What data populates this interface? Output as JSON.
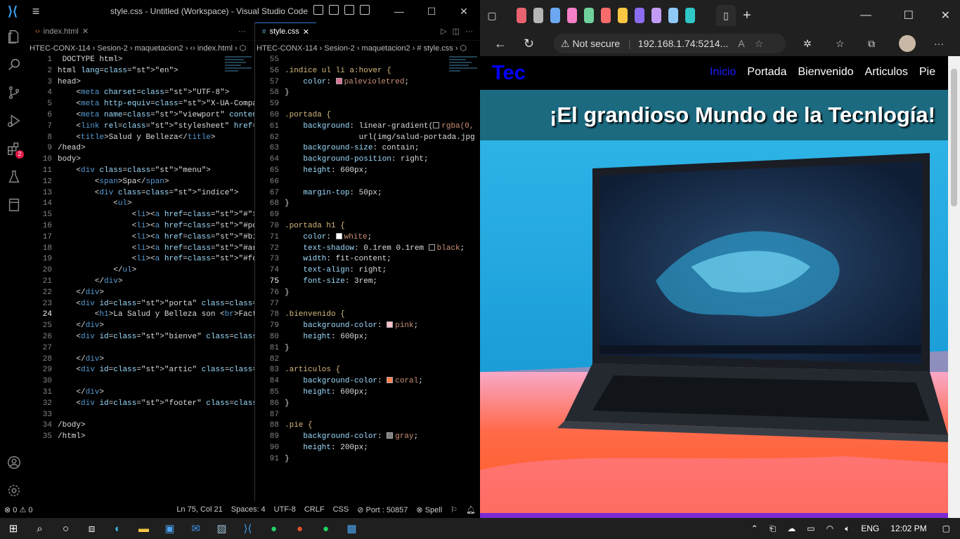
{
  "vscode": {
    "title": "style.css - Untitled (Workspace) - Visual Studio Code",
    "left_tab": "index.html",
    "right_tab": "style.css",
    "left_breadcrumb": "HTEC-CONX-114 › Sesion-2 › maquetacion2 › ‹› index.html › ⬡",
    "right_breadcrumb": "HTEC-CONX-114 › Sesion-2 › maquetacion2 › # style.css › ⬡",
    "activity_badge": "2",
    "status": {
      "errors": "⊗ 0 ⚠ 0",
      "position": "Ln 75, Col 21",
      "spaces": "Spaces: 4",
      "encoding": "UTF-8",
      "eol": "CRLF",
      "lang": "CSS",
      "port": "⊘ Port : 50857",
      "spell": "⊗ Spell"
    }
  },
  "html_lines": [
    {
      "n": "1",
      "t": " DOCTYPE html>"
    },
    {
      "n": "2",
      "t": "html lang=\"en\">"
    },
    {
      "n": "3",
      "t": "head>"
    },
    {
      "n": "4",
      "t": "    <meta charset=\"UTF-8\">"
    },
    {
      "n": "5",
      "t": "    <meta http-equiv=\"X-UA-Compatible\" cont"
    },
    {
      "n": "6",
      "t": "    <meta name=\"viewport\" content=\"width=de"
    },
    {
      "n": "7",
      "t": "    <link rel=\"stylesheet\" href=\"style.css\""
    },
    {
      "n": "8",
      "t": "    <title>Salud y Belleza</title>"
    },
    {
      "n": "9",
      "t": "/head>"
    },
    {
      "n": "10",
      "t": "body>"
    },
    {
      "n": "11",
      "t": "    <div class=\"menu\">"
    },
    {
      "n": "12",
      "t": "        <span>Spa</span>"
    },
    {
      "n": "13",
      "t": "        <div class=\"indice\">"
    },
    {
      "n": "14",
      "t": "            <ul>"
    },
    {
      "n": "15",
      "t": "                <li><a href=\"#\">Inicio</a><"
    },
    {
      "n": "16",
      "t": "                <li><a href=\"#porta\">Portad"
    },
    {
      "n": "17",
      "t": "                <li><a href=\"#bienve\">Bienv"
    },
    {
      "n": "18",
      "t": "                <li><a href=\"#artic\">Articu"
    },
    {
      "n": "19",
      "t": "                <li><a href=\"#footer\">Pie</"
    },
    {
      "n": "20",
      "t": "            </ul>"
    },
    {
      "n": "21",
      "t": "        </div>"
    },
    {
      "n": "22",
      "t": "    </div>"
    },
    {
      "n": "23",
      "t": "    <div id=\"porta\" class=\"portada\">"
    },
    {
      "n": "24",
      "t": "        <h1>La Salud y Belleza son <br>Fact"
    },
    {
      "n": "25",
      "t": "    </div>"
    },
    {
      "n": "26",
      "t": "    <div id=\"bienve\" class=\"bienvenido\">"
    },
    {
      "n": "27",
      "t": ""
    },
    {
      "n": "28",
      "t": "    </div>"
    },
    {
      "n": "29",
      "t": "    <div id=\"artic\" class=\"articulos\">"
    },
    {
      "n": "30",
      "t": ""
    },
    {
      "n": "31",
      "t": "    </div>"
    },
    {
      "n": "32",
      "t": "    <div id=\"footer\" class=\"pie\">"
    },
    {
      "n": "33",
      "t": ""
    },
    {
      "n": "34",
      "t": "/body>"
    },
    {
      "n": "35",
      "t": "/html>"
    }
  ],
  "css_lines": [
    {
      "n": "55",
      "t": ""
    },
    {
      "n": "56",
      "t": ".indice ul li a:hover {"
    },
    {
      "n": "57",
      "t": "    color: ■palevioletred;"
    },
    {
      "n": "58",
      "t": "}"
    },
    {
      "n": "59",
      "t": ""
    },
    {
      "n": "60",
      "t": ".portada {"
    },
    {
      "n": "61",
      "t": "    background: linear-gradient(□rgba(0,"
    },
    {
      "n": "62",
      "t": "                url(img/salud-portada.jpg"
    },
    {
      "n": "63",
      "t": "    background-size: contain;"
    },
    {
      "n": "64",
      "t": "    background-position: right;"
    },
    {
      "n": "65",
      "t": "    height: 600px;"
    },
    {
      "n": "66",
      "t": ""
    },
    {
      "n": "67",
      "t": "    margin-top: 50px;"
    },
    {
      "n": "68",
      "t": "}"
    },
    {
      "n": "69",
      "t": ""
    },
    {
      "n": "70",
      "t": ".portada h1 {"
    },
    {
      "n": "71",
      "t": "    color: ■white;"
    },
    {
      "n": "72",
      "t": "    text-shadow: 0.1rem 0.1rem □black;"
    },
    {
      "n": "73",
      "t": "    width: fit-content;"
    },
    {
      "n": "74",
      "t": "    text-align: right;"
    },
    {
      "n": "75",
      "t": "    font-size: 3rem;"
    },
    {
      "n": "76",
      "t": "}"
    },
    {
      "n": "77",
      "t": ""
    },
    {
      "n": "78",
      "t": ".bienvenido {"
    },
    {
      "n": "79",
      "t": "    background-color: ■pink;"
    },
    {
      "n": "80",
      "t": "    height: 600px;"
    },
    {
      "n": "81",
      "t": "}"
    },
    {
      "n": "82",
      "t": ""
    },
    {
      "n": "83",
      "t": ".articulos {"
    },
    {
      "n": "84",
      "t": "    background-color: ■coral;"
    },
    {
      "n": "85",
      "t": "    height: 600px;"
    },
    {
      "n": "86",
      "t": "}"
    },
    {
      "n": "87",
      "t": ""
    },
    {
      "n": "88",
      "t": ".pie {"
    },
    {
      "n": "89",
      "t": "    background-color: ■gray;"
    },
    {
      "n": "90",
      "t": "    height: 200px;"
    },
    {
      "n": "91",
      "t": "}"
    }
  ],
  "browser": {
    "security": "⚠ Not secure",
    "url": "192.168.1.74:5214...",
    "site_logo": "Tec",
    "nav_links": [
      "Inicio",
      "Portada",
      "Bienvenido",
      "Articulos",
      "Pie"
    ],
    "hero_title": "¡El grandioso Mundo de la Tecnlogía!",
    "tab_colors": [
      "#e8636f",
      "#b5b5b5",
      "#6ca8f2",
      "#f47fc6",
      "#6fd19b",
      "#f76b6b",
      "#f9c742",
      "#8c6cf0",
      "#c39bf7",
      "#8fc9f6",
      "#2fc7c7"
    ]
  },
  "taskbar": {
    "lang": "ENG",
    "time": "12:02 PM"
  },
  "colors": {
    "accent": "#3a7bd5",
    "site_bg": "#0a8fc4",
    "hero_bg": "#1b6a80",
    "logo": "#0000ff"
  }
}
